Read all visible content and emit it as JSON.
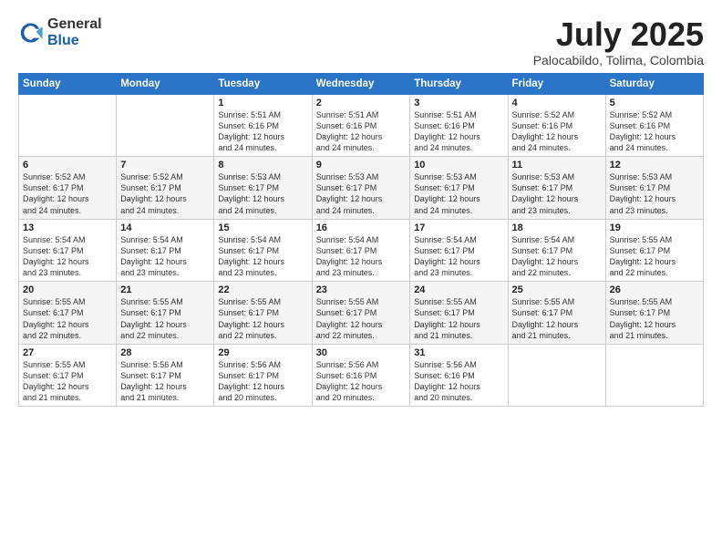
{
  "logo": {
    "general": "General",
    "blue": "Blue"
  },
  "header": {
    "month": "July 2025",
    "location": "Palocabildo, Tolima, Colombia"
  },
  "weekdays": [
    "Sunday",
    "Monday",
    "Tuesday",
    "Wednesday",
    "Thursday",
    "Friday",
    "Saturday"
  ],
  "weeks": [
    [
      {
        "day": "",
        "info": ""
      },
      {
        "day": "",
        "info": ""
      },
      {
        "day": "1",
        "info": "Sunrise: 5:51 AM\nSunset: 6:16 PM\nDaylight: 12 hours\nand 24 minutes."
      },
      {
        "day": "2",
        "info": "Sunrise: 5:51 AM\nSunset: 6:16 PM\nDaylight: 12 hours\nand 24 minutes."
      },
      {
        "day": "3",
        "info": "Sunrise: 5:51 AM\nSunset: 6:16 PM\nDaylight: 12 hours\nand 24 minutes."
      },
      {
        "day": "4",
        "info": "Sunrise: 5:52 AM\nSunset: 6:16 PM\nDaylight: 12 hours\nand 24 minutes."
      },
      {
        "day": "5",
        "info": "Sunrise: 5:52 AM\nSunset: 6:16 PM\nDaylight: 12 hours\nand 24 minutes."
      }
    ],
    [
      {
        "day": "6",
        "info": "Sunrise: 5:52 AM\nSunset: 6:17 PM\nDaylight: 12 hours\nand 24 minutes."
      },
      {
        "day": "7",
        "info": "Sunrise: 5:52 AM\nSunset: 6:17 PM\nDaylight: 12 hours\nand 24 minutes."
      },
      {
        "day": "8",
        "info": "Sunrise: 5:53 AM\nSunset: 6:17 PM\nDaylight: 12 hours\nand 24 minutes."
      },
      {
        "day": "9",
        "info": "Sunrise: 5:53 AM\nSunset: 6:17 PM\nDaylight: 12 hours\nand 24 minutes."
      },
      {
        "day": "10",
        "info": "Sunrise: 5:53 AM\nSunset: 6:17 PM\nDaylight: 12 hours\nand 24 minutes."
      },
      {
        "day": "11",
        "info": "Sunrise: 5:53 AM\nSunset: 6:17 PM\nDaylight: 12 hours\nand 23 minutes."
      },
      {
        "day": "12",
        "info": "Sunrise: 5:53 AM\nSunset: 6:17 PM\nDaylight: 12 hours\nand 23 minutes."
      }
    ],
    [
      {
        "day": "13",
        "info": "Sunrise: 5:54 AM\nSunset: 6:17 PM\nDaylight: 12 hours\nand 23 minutes."
      },
      {
        "day": "14",
        "info": "Sunrise: 5:54 AM\nSunset: 6:17 PM\nDaylight: 12 hours\nand 23 minutes."
      },
      {
        "day": "15",
        "info": "Sunrise: 5:54 AM\nSunset: 6:17 PM\nDaylight: 12 hours\nand 23 minutes."
      },
      {
        "day": "16",
        "info": "Sunrise: 5:54 AM\nSunset: 6:17 PM\nDaylight: 12 hours\nand 23 minutes."
      },
      {
        "day": "17",
        "info": "Sunrise: 5:54 AM\nSunset: 6:17 PM\nDaylight: 12 hours\nand 23 minutes."
      },
      {
        "day": "18",
        "info": "Sunrise: 5:54 AM\nSunset: 6:17 PM\nDaylight: 12 hours\nand 22 minutes."
      },
      {
        "day": "19",
        "info": "Sunrise: 5:55 AM\nSunset: 6:17 PM\nDaylight: 12 hours\nand 22 minutes."
      }
    ],
    [
      {
        "day": "20",
        "info": "Sunrise: 5:55 AM\nSunset: 6:17 PM\nDaylight: 12 hours\nand 22 minutes."
      },
      {
        "day": "21",
        "info": "Sunrise: 5:55 AM\nSunset: 6:17 PM\nDaylight: 12 hours\nand 22 minutes."
      },
      {
        "day": "22",
        "info": "Sunrise: 5:55 AM\nSunset: 6:17 PM\nDaylight: 12 hours\nand 22 minutes."
      },
      {
        "day": "23",
        "info": "Sunrise: 5:55 AM\nSunset: 6:17 PM\nDaylight: 12 hours\nand 22 minutes."
      },
      {
        "day": "24",
        "info": "Sunrise: 5:55 AM\nSunset: 6:17 PM\nDaylight: 12 hours\nand 21 minutes."
      },
      {
        "day": "25",
        "info": "Sunrise: 5:55 AM\nSunset: 6:17 PM\nDaylight: 12 hours\nand 21 minutes."
      },
      {
        "day": "26",
        "info": "Sunrise: 5:55 AM\nSunset: 6:17 PM\nDaylight: 12 hours\nand 21 minutes."
      }
    ],
    [
      {
        "day": "27",
        "info": "Sunrise: 5:55 AM\nSunset: 6:17 PM\nDaylight: 12 hours\nand 21 minutes."
      },
      {
        "day": "28",
        "info": "Sunrise: 5:56 AM\nSunset: 6:17 PM\nDaylight: 12 hours\nand 21 minutes."
      },
      {
        "day": "29",
        "info": "Sunrise: 5:56 AM\nSunset: 6:17 PM\nDaylight: 12 hours\nand 20 minutes."
      },
      {
        "day": "30",
        "info": "Sunrise: 5:56 AM\nSunset: 6:16 PM\nDaylight: 12 hours\nand 20 minutes."
      },
      {
        "day": "31",
        "info": "Sunrise: 5:56 AM\nSunset: 6:16 PM\nDaylight: 12 hours\nand 20 minutes."
      },
      {
        "day": "",
        "info": ""
      },
      {
        "day": "",
        "info": ""
      }
    ]
  ]
}
